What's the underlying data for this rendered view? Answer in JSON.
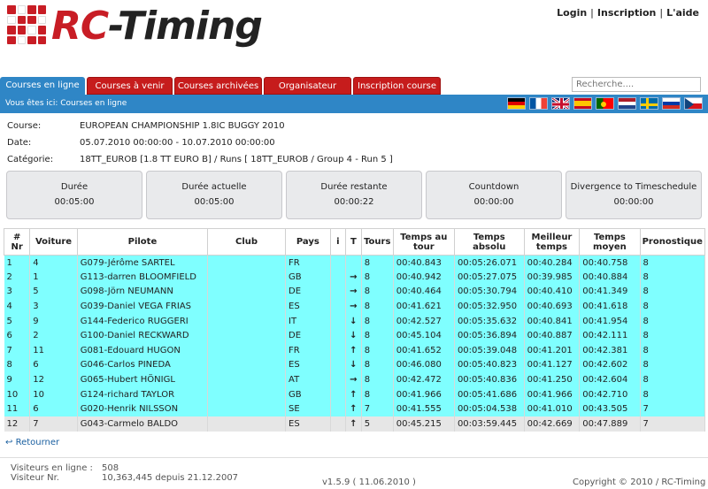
{
  "brand": {
    "rc": "RC",
    "rest": "-Timing"
  },
  "top_links": {
    "login": "Login",
    "inscription": "Inscription",
    "aide": "L'aide"
  },
  "tabs": [
    {
      "label": "Courses en ligne"
    },
    {
      "label": "Courses à venir"
    },
    {
      "label": "Courses archivées"
    },
    {
      "label": "Organisateur"
    },
    {
      "label": "Inscription course"
    }
  ],
  "search": {
    "placeholder": "Recherche...."
  },
  "breadcrumb": "Vous êtes ici: Courses en ligne",
  "flags": [
    "de",
    "fr",
    "gb",
    "es",
    "pt",
    "nl",
    "se",
    "ru",
    "cz"
  ],
  "info": {
    "course_label": "Course:",
    "course_value": "EUROPEAN CHAMPIONSHIP 1.8IC BUGGY 2010",
    "date_label": "Date:",
    "date_value": "05.07.2010 00:00:00 - 10.07.2010 00:00:00",
    "categorie_label": "Catégorie:",
    "categorie_value": "18TT_EUROB [1.8 TT EURO B] / Runs [ 18TT_EUROB / Group 4 - Run 5 ]"
  },
  "timers": [
    {
      "label": "Durée",
      "value": "00:05:00"
    },
    {
      "label": "Durée actuelle",
      "value": "00:05:00"
    },
    {
      "label": "Durée restante",
      "value": "00:00:22"
    },
    {
      "label": "Countdown",
      "value": "00:00:00"
    },
    {
      "label": "Divergence to Timeschedule",
      "value": "00:00:00"
    }
  ],
  "table": {
    "headers": {
      "nr": "# Nr",
      "voiture": "Voiture",
      "pilote": "Pilote",
      "club": "Club",
      "pays": "Pays",
      "i": "i",
      "t": "T",
      "tours": "Tours",
      "temps_tour_1": "Temps au",
      "temps_tour_2": "tour",
      "temps_absolu": "Temps absolu",
      "meilleur_1": "Meilleur",
      "meilleur_2": "temps",
      "moyen_1": "Temps",
      "moyen_2": "moyen",
      "pronostique": "Pronostique"
    },
    "rows": [
      {
        "nr": "1",
        "voiture": "4",
        "pilote": "G079-Jérôme SARTEL",
        "club": "",
        "pays": "FR",
        "trend": "",
        "tours": "8",
        "tour": "00:40.843",
        "absolu": "00:05:26.071",
        "meilleur": "00:40.284",
        "moyen": "00:40.758",
        "prono": "8",
        "style": "cyan"
      },
      {
        "nr": "2",
        "voiture": "1",
        "pilote": "G113-darren BLOOMFIELD",
        "club": "",
        "pays": "GB",
        "trend": "→",
        "tours": "8",
        "tour": "00:40.942",
        "absolu": "00:05:27.075",
        "meilleur": "00:39.985",
        "moyen": "00:40.884",
        "prono": "8",
        "style": "cyan"
      },
      {
        "nr": "3",
        "voiture": "5",
        "pilote": "G098-Jörn NEUMANN",
        "club": "",
        "pays": "DE",
        "trend": "→",
        "tours": "8",
        "tour": "00:40.464",
        "absolu": "00:05:30.794",
        "meilleur": "00:40.410",
        "moyen": "00:41.349",
        "prono": "8",
        "style": "cyan"
      },
      {
        "nr": "4",
        "voiture": "3",
        "pilote": "G039-Daniel VEGA FRIAS",
        "club": "",
        "pays": "ES",
        "trend": "→",
        "tours": "8",
        "tour": "00:41.621",
        "absolu": "00:05:32.950",
        "meilleur": "00:40.693",
        "moyen": "00:41.618",
        "prono": "8",
        "style": "cyan"
      },
      {
        "nr": "5",
        "voiture": "9",
        "pilote": "G144-Federico RUGGERI",
        "club": "",
        "pays": "IT",
        "trend": "↓",
        "tours": "8",
        "tour": "00:42.527",
        "absolu": "00:05:35.632",
        "meilleur": "00:40.841",
        "moyen": "00:41.954",
        "prono": "8",
        "style": "cyan"
      },
      {
        "nr": "6",
        "voiture": "2",
        "pilote": "G100-Daniel RECKWARD",
        "club": "",
        "pays": "DE",
        "trend": "↓",
        "tours": "8",
        "tour": "00:45.104",
        "absolu": "00:05:36.894",
        "meilleur": "00:40.887",
        "moyen": "00:42.111",
        "prono": "8",
        "style": "cyan"
      },
      {
        "nr": "7",
        "voiture": "11",
        "pilote": "G081-Edouard HUGON",
        "club": "",
        "pays": "FR",
        "trend": "↑",
        "tours": "8",
        "tour": "00:41.652",
        "absolu": "00:05:39.048",
        "meilleur": "00:41.201",
        "moyen": "00:42.381",
        "prono": "8",
        "style": "cyan"
      },
      {
        "nr": "8",
        "voiture": "6",
        "pilote": "G046-Carlos PINEDA",
        "club": "",
        "pays": "ES",
        "trend": "↓",
        "tours": "8",
        "tour": "00:46.080",
        "absolu": "00:05:40.823",
        "meilleur": "00:41.127",
        "moyen": "00:42.602",
        "prono": "8",
        "style": "cyan"
      },
      {
        "nr": "9",
        "voiture": "12",
        "pilote": "G065-Hubert HÖNIGL",
        "club": "",
        "pays": "AT",
        "trend": "→",
        "tours": "8",
        "tour": "00:42.472",
        "absolu": "00:05:40.836",
        "meilleur": "00:41.250",
        "moyen": "00:42.604",
        "prono": "8",
        "style": "cyan"
      },
      {
        "nr": "10",
        "voiture": "10",
        "pilote": "G124-richard TAYLOR",
        "club": "",
        "pays": "GB",
        "trend": "↑",
        "tours": "8",
        "tour": "00:41.966",
        "absolu": "00:05:41.686",
        "meilleur": "00:41.966",
        "moyen": "00:42.710",
        "prono": "8",
        "style": "cyan"
      },
      {
        "nr": "11",
        "voiture": "6",
        "pilote": "G020-Henrik NILSSON",
        "club": "",
        "pays": "SE",
        "trend": "↑",
        "tours": "7",
        "tour": "00:41.555",
        "absolu": "00:05:04.538",
        "meilleur": "00:41.010",
        "moyen": "00:43.505",
        "prono": "7",
        "style": "cyan"
      },
      {
        "nr": "12",
        "voiture": "7",
        "pilote": "G043-Carmelo BALDO",
        "club": "",
        "pays": "ES",
        "trend": "↑",
        "tours": "5",
        "tour": "00:45.215",
        "absolu": "00:03:59.445",
        "meilleur": "00:42.669",
        "moyen": "00:47.889",
        "prono": "7",
        "style": "grey"
      }
    ]
  },
  "retour": "Retourner",
  "footer": {
    "visiteurs_label": "Visiteurs en ligne :",
    "visiteurs_value": "508",
    "visiteur_nr_label": "Visiteur Nr.",
    "visiteur_nr_value": "10,363,445 depuis 21.12.2007",
    "version": "v1.5.9 ( 11.06.2010 )",
    "copyright": "Copyright © 2010 / RC-Timing"
  }
}
